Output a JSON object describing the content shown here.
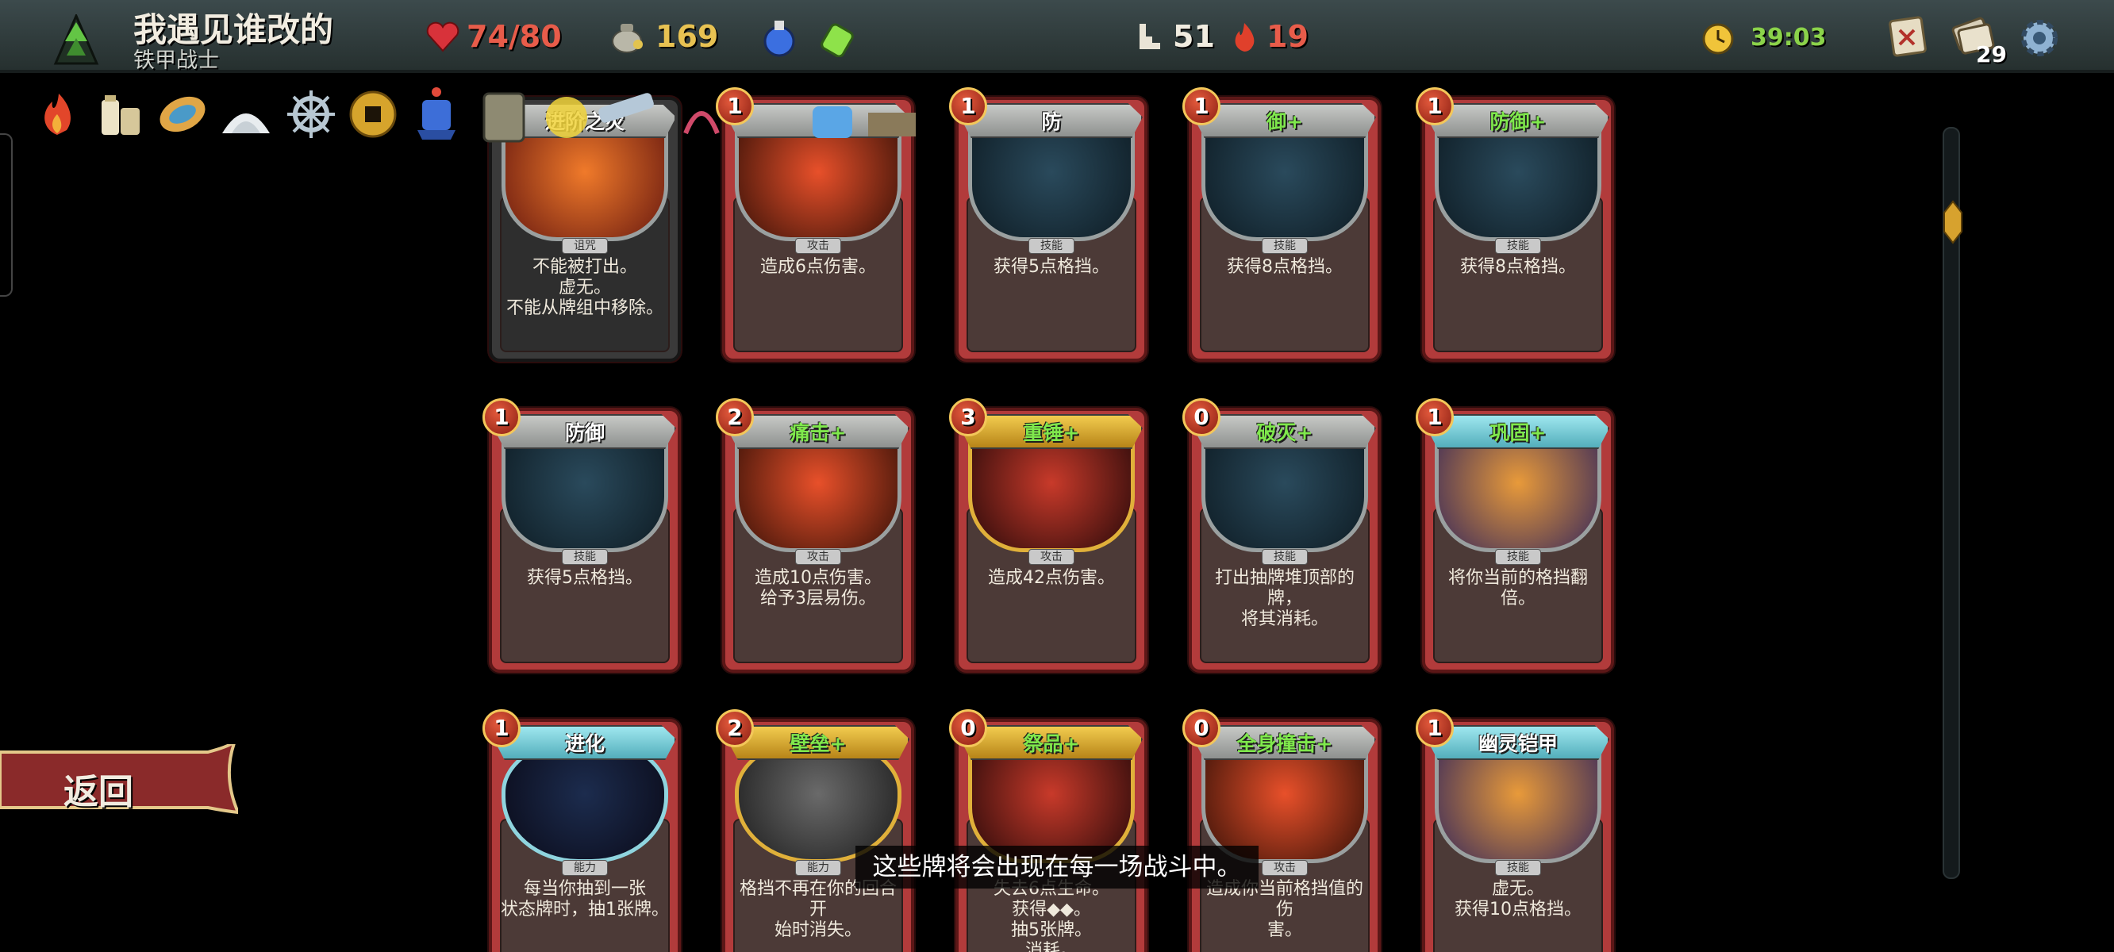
{
  "player": {
    "name": "我遇见谁改的",
    "class": "铁甲战士"
  },
  "stats": {
    "hp": "74/80",
    "gold": "169",
    "floor": "51",
    "ascension": "19",
    "timer": "39:03",
    "deck_count": "29"
  },
  "colors": {
    "hp": "#e85c4a",
    "gold": "#e8c252",
    "timer": "#8bd34a",
    "upgraded_title": "#7fe84c",
    "keyword": "#f2c14e",
    "attack_frame": "#b23b3b"
  },
  "icons": {
    "topbar": [
      "rank-icon",
      "heart-icon",
      "gold-bag-icon",
      "blue-potion-icon",
      "green-potion-icon",
      "stairs-icon",
      "flame-icon",
      "clock-icon",
      "map-icon",
      "deck-icon",
      "settings-icon"
    ],
    "relics": [
      "burning-blood-relic",
      "tubes-relic",
      "leaf-relic",
      "salt-pile-relic",
      "ship-wheel-relic",
      "coin-relic",
      "blue-lantern-relic"
    ]
  },
  "cards": [
    {
      "cost": "",
      "title": "进阶之灾",
      "type": "诅咒",
      "text": [
        "不能被打出。",
        "虚无。",
        "不能从牌组中移除。"
      ],
      "frame": "curse",
      "upgraded": false
    },
    {
      "cost": "1",
      "title": "",
      "type": "攻击",
      "text": [
        "造成6点伤害。"
      ],
      "frame": "attack",
      "upgraded": false
    },
    {
      "cost": "1",
      "title": "防",
      "type": "技能",
      "text": [
        "获得5点格挡。"
      ],
      "frame": "skill",
      "upgraded": false
    },
    {
      "cost": "1",
      "title": "御+",
      "type": "技能",
      "text": [
        "获得8点格挡。"
      ],
      "frame": "skill",
      "upgraded": true
    },
    {
      "cost": "1",
      "title": "防御+",
      "type": "技能",
      "text": [
        "获得8点格挡。"
      ],
      "frame": "skill",
      "upgraded": true
    },
    {
      "cost": "1",
      "title": "防御",
      "type": "技能",
      "text": [
        "获得5点格挡。"
      ],
      "frame": "skill",
      "upgraded": false
    },
    {
      "cost": "2",
      "title": "痛击+",
      "type": "攻击",
      "text": [
        "造成10点伤害。",
        "给予3层易伤。"
      ],
      "frame": "attack",
      "upgraded": true
    },
    {
      "cost": "3",
      "title": "重锤+",
      "type": "攻击",
      "text": [
        "造成42点伤害。"
      ],
      "frame": "gold",
      "upgraded": true
    },
    {
      "cost": "0",
      "title": "破灭+",
      "type": "技能",
      "text": [
        "打出抽牌堆顶部的牌，",
        "将其消耗。"
      ],
      "frame": "skill",
      "upgraded": true
    },
    {
      "cost": "1",
      "title": "巩固+",
      "type": "技能",
      "text": [
        "将你当前的格挡翻倍。"
      ],
      "frame": "blue",
      "upgraded": true
    },
    {
      "cost": "1",
      "title": "进化",
      "type": "能力",
      "text": [
        "每当你抽到一张",
        "状态牌时，抽1张牌。"
      ],
      "frame": "power",
      "upgraded": false
    },
    {
      "cost": "2",
      "title": "壁垒+",
      "type": "能力",
      "text": [
        "格挡不再在你的回合开",
        "始时消失。"
      ],
      "frame": "power-gold",
      "upgraded": true
    },
    {
      "cost": "0",
      "title": "祭品+",
      "type": "",
      "text": [
        "失去6点生命。",
        "获得◆◆。",
        "抽5张牌。",
        "消耗。"
      ],
      "frame": "gold",
      "upgraded": true
    },
    {
      "cost": "0",
      "title": "全身撞击+",
      "type": "攻击",
      "text": [
        "造成你当前格挡值的伤",
        "害。"
      ],
      "frame": "attack",
      "upgraded": true
    },
    {
      "cost": "1",
      "title": "幽灵铠甲",
      "type": "技能",
      "text": [
        "虚无。",
        "获得10点格挡。"
      ],
      "frame": "blue",
      "upgraded": false
    }
  ],
  "back_button": {
    "label": "返回"
  },
  "tooltip": "这些牌将会出现在每一场战斗中。"
}
